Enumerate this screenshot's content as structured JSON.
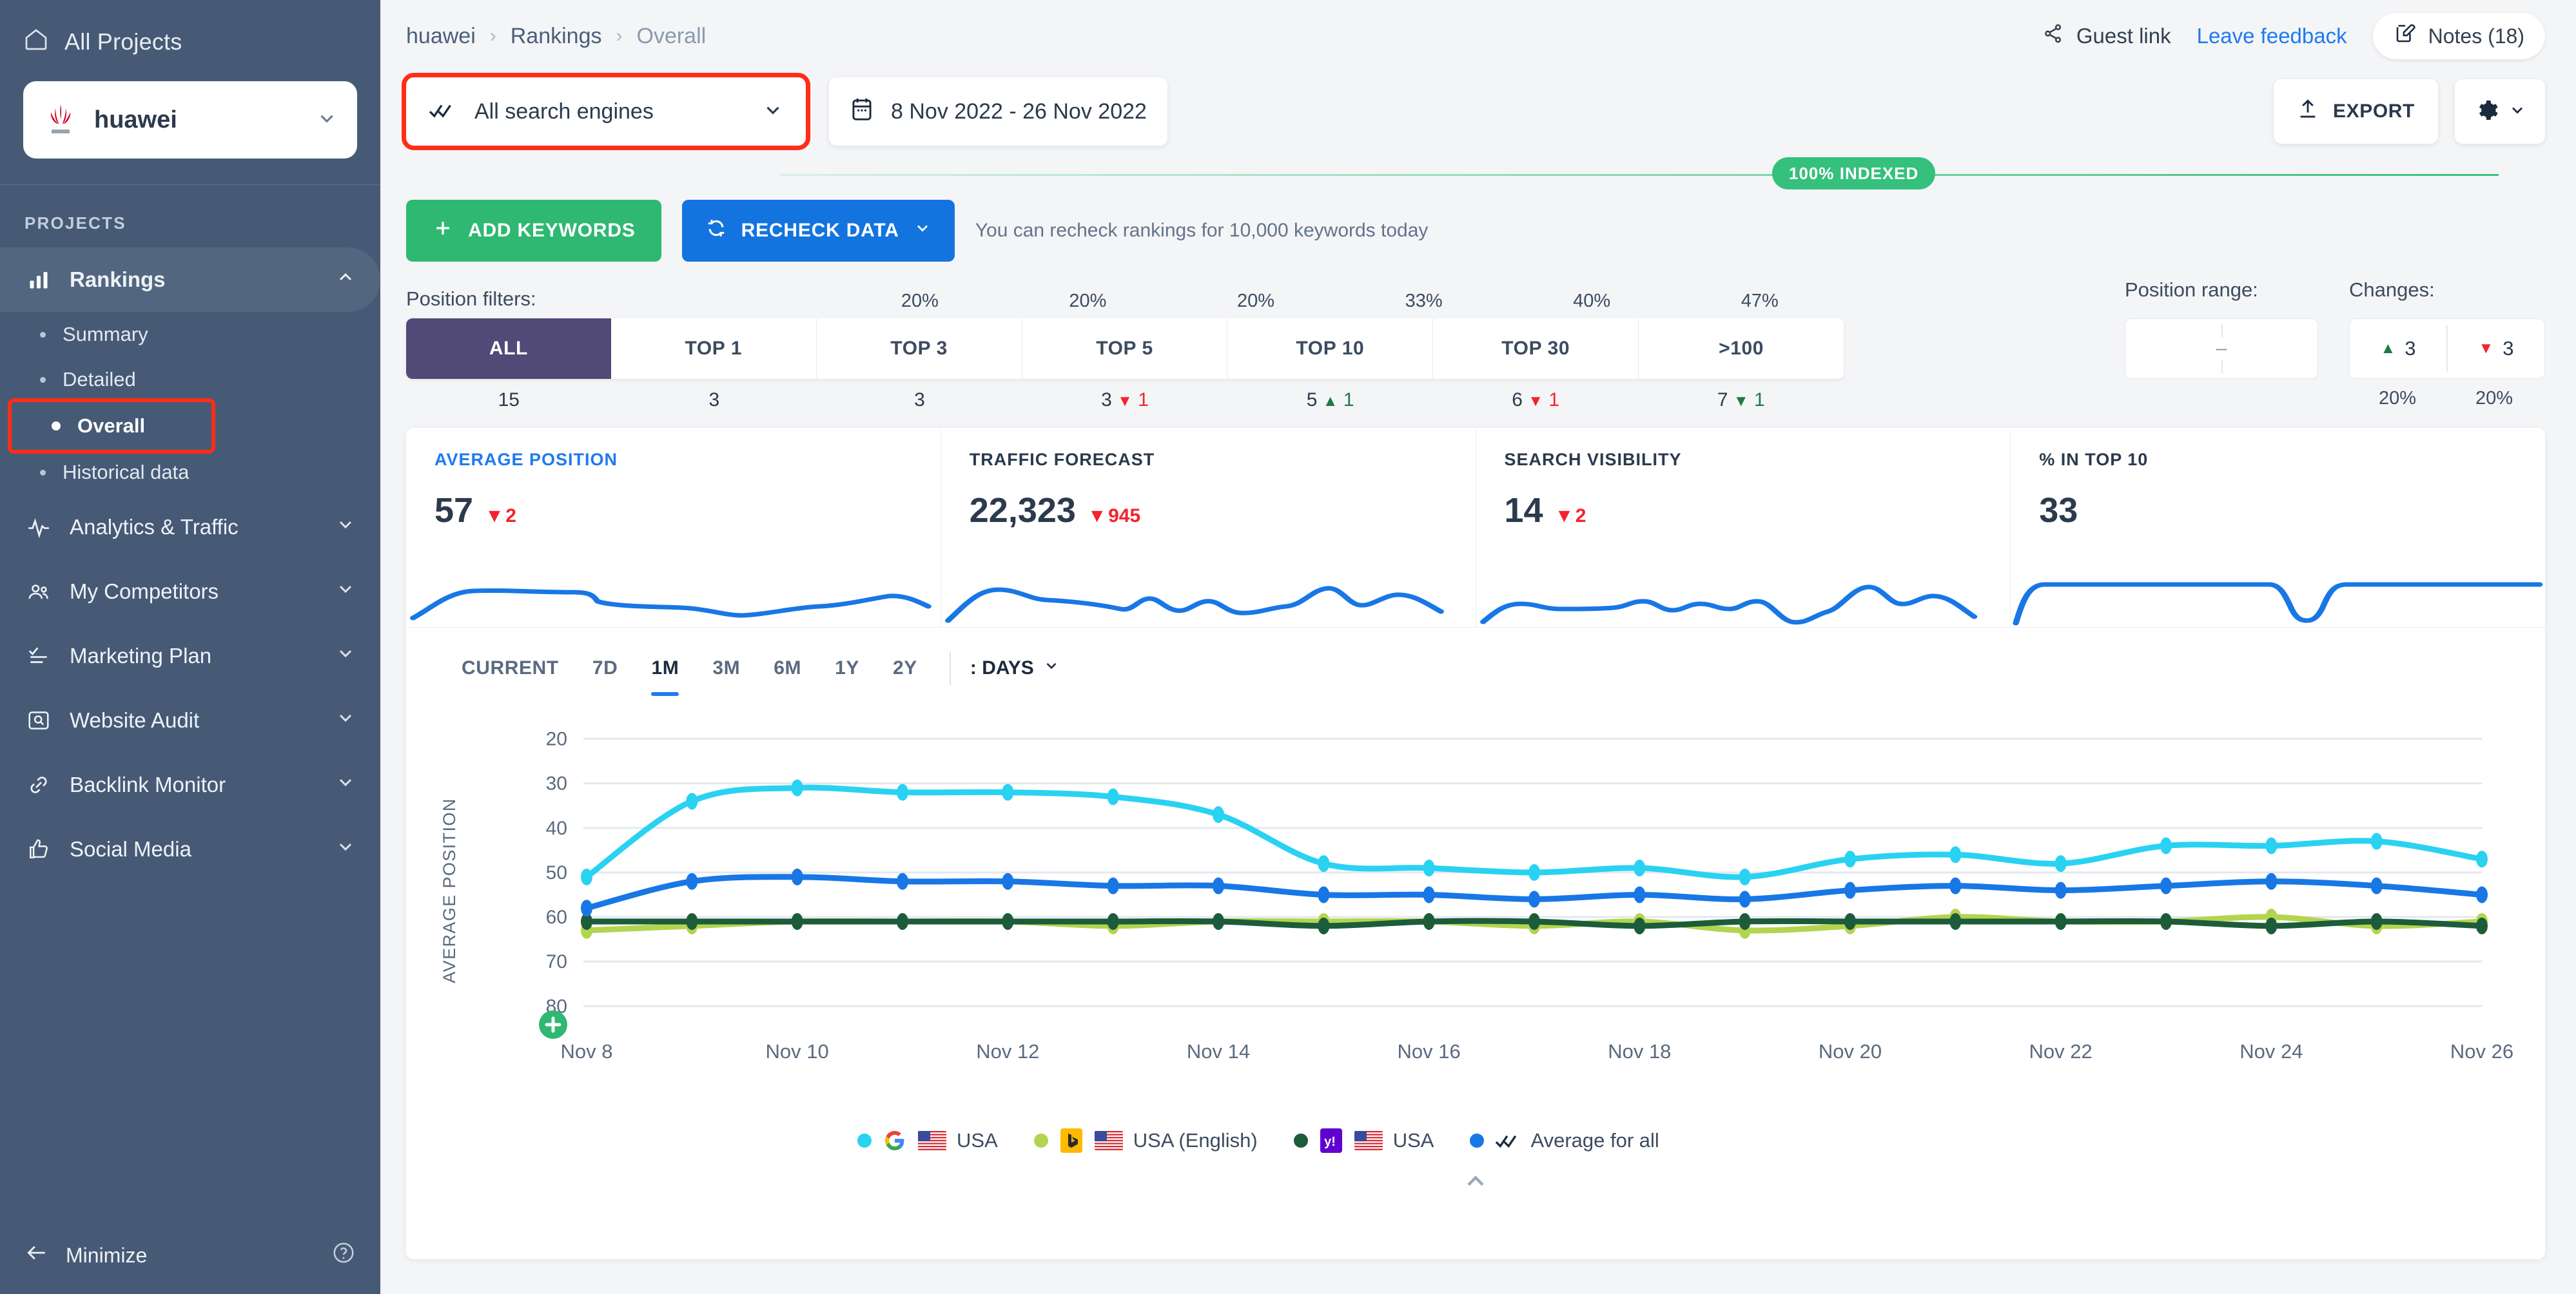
{
  "sidebar": {
    "all_projects": "All Projects",
    "project_name": "huawei",
    "section_label": "PROJECTS",
    "items": [
      {
        "label": "Rankings",
        "icon": "bar-chart-icon",
        "expanded": true
      },
      {
        "label": "Analytics & Traffic",
        "icon": "pulse-icon",
        "expanded": false
      },
      {
        "label": "My Competitors",
        "icon": "people-icon",
        "expanded": false
      },
      {
        "label": "Marketing Plan",
        "icon": "checklist-icon",
        "expanded": false
      },
      {
        "label": "Website Audit",
        "icon": "magnifier-box-icon",
        "expanded": false
      },
      {
        "label": "Backlink Monitor",
        "icon": "link-icon",
        "expanded": false
      },
      {
        "label": "Social Media",
        "icon": "thumbs-up-icon",
        "expanded": false
      }
    ],
    "rankings_sub": [
      "Summary",
      "Detailed",
      "Overall",
      "Historical data"
    ],
    "selected_sub": "Overall",
    "minimize": "Minimize"
  },
  "header": {
    "breadcrumb": [
      "huawei",
      "Rankings",
      "Overall"
    ],
    "guest_link": "Guest link",
    "leave_feedback": "Leave feedback",
    "notes": "Notes (18)"
  },
  "filters": {
    "search_engine": "All search engines",
    "date_range": "8 Nov 2022 - 26 Nov 2022",
    "export": "EXPORT",
    "indexed_badge": "100% INDEXED"
  },
  "actions": {
    "add_keywords": "ADD KEYWORDS",
    "recheck_data": "RECHECK DATA",
    "recheck_note": "You can recheck rankings for 10,000 keywords today"
  },
  "position_filters": {
    "label": "Position filters:",
    "tabs": [
      {
        "label": "ALL",
        "pct": "",
        "count": "15",
        "delta": "",
        "dir": ""
      },
      {
        "label": "TOP 1",
        "pct": "20%",
        "count": "3",
        "delta": "",
        "dir": ""
      },
      {
        "label": "TOP 3",
        "pct": "20%",
        "count": "3",
        "delta": "",
        "dir": ""
      },
      {
        "label": "TOP 5",
        "pct": "20%",
        "count": "3",
        "delta": "1",
        "dir": "down"
      },
      {
        "label": "TOP 10",
        "pct": "33%",
        "count": "5",
        "delta": "1",
        "dir": "up"
      },
      {
        "label": "TOP 30",
        "pct": "40%",
        "count": "6",
        "delta": "1",
        "dir": "down"
      },
      {
        "label": ">100",
        "pct": "47%",
        "count": "7",
        "delta": "1",
        "dir": "down"
      }
    ],
    "active_tab": "ALL"
  },
  "position_range": {
    "title": "Position range:",
    "value": "–"
  },
  "changes": {
    "title": "Changes:",
    "up_count": "3",
    "down_count": "3",
    "up_pct": "20%",
    "down_pct": "20%"
  },
  "kpis": [
    {
      "title": "AVERAGE POSITION",
      "value": "57",
      "delta": "2",
      "dir": "down",
      "active": true
    },
    {
      "title": "TRAFFIC FORECAST",
      "value": "22,323",
      "delta": "945",
      "dir": "down",
      "active": false
    },
    {
      "title": "SEARCH VISIBILITY",
      "value": "14",
      "delta": "2",
      "dir": "down",
      "active": false
    },
    {
      "title": "% IN TOP 10",
      "value": "33",
      "delta": "",
      "dir": "",
      "active": false
    }
  ],
  "time_ranges": {
    "options": [
      "CURRENT",
      "7D",
      "1M",
      "3M",
      "6M",
      "1Y",
      "2Y"
    ],
    "active": "1M",
    "granularity": ": DAYS"
  },
  "chart_data": {
    "type": "line",
    "title": "",
    "xlabel": "",
    "ylabel": "AVERAGE POSITION",
    "yticks": [
      20,
      30,
      40,
      50,
      60,
      70,
      80
    ],
    "ylim": [
      15,
      83
    ],
    "y_inverted": true,
    "grid": true,
    "legend_position": "bottom",
    "x": [
      "Nov 8",
      "Nov 9",
      "Nov 10",
      "Nov 11",
      "Nov 12",
      "Nov 13",
      "Nov 14",
      "Nov 15",
      "Nov 16",
      "Nov 17",
      "Nov 18",
      "Nov 19",
      "Nov 20",
      "Nov 21",
      "Nov 22",
      "Nov 23",
      "Nov 24",
      "Nov 25",
      "Nov 26"
    ],
    "xticks": [
      "Nov 8",
      "Nov 10",
      "Nov 12",
      "Nov 14",
      "Nov 16",
      "Nov 18",
      "Nov 20",
      "Nov 22",
      "Nov 24",
      "Nov 26"
    ],
    "series": [
      {
        "name": "USA",
        "engine": "Google",
        "color": "#2ad2f2",
        "values": [
          51,
          34,
          31,
          32,
          32,
          33,
          37,
          48,
          49,
          50,
          49,
          51,
          47,
          46,
          48,
          44,
          44,
          43,
          47
        ]
      },
      {
        "name": "USA (English)",
        "engine": "Bing",
        "color": "#b3d44f",
        "values": [
          63,
          62,
          61,
          61,
          61,
          62,
          61,
          61,
          61,
          62,
          61,
          63,
          62,
          60,
          61,
          61,
          60,
          62,
          61
        ]
      },
      {
        "name": "USA",
        "engine": "Yahoo",
        "color": "#1c5c3a",
        "values": [
          61,
          61,
          61,
          61,
          61,
          61,
          61,
          62,
          61,
          61,
          62,
          61,
          61,
          61,
          61,
          61,
          62,
          61,
          62
        ]
      },
      {
        "name": "Average for all",
        "engine": "All",
        "color": "#1877e5",
        "values": [
          58,
          52,
          51,
          52,
          52,
          53,
          53,
          55,
          55,
          56,
          55,
          56,
          54,
          53,
          54,
          53,
          52,
          53,
          55
        ]
      }
    ],
    "legend": [
      {
        "label": "USA",
        "color": "#2ad2f2",
        "engine_icon": "google-icon",
        "flag": "us-flag"
      },
      {
        "label": "USA (English)",
        "color": "#b3d44f",
        "engine_icon": "bing-icon",
        "flag": "us-flag"
      },
      {
        "label": "USA",
        "color": "#1c5c3a",
        "engine_icon": "yahoo-icon",
        "flag": "us-flag"
      },
      {
        "label": "Average for all",
        "color": "#1877e5",
        "engine_icon": "all-engines-icon",
        "flag": ""
      }
    ],
    "annotations": [
      {
        "type": "add-note-marker",
        "x": "Nov 8",
        "icon": "plus-circle-icon",
        "color": "#2eb872"
      }
    ]
  },
  "colors": {
    "sidebar_bg": "#465a75",
    "accent_blue": "#1f7af0",
    "green": "#2eb872",
    "red": "#f5222d",
    "purple": "#514a77",
    "highlight": "#ff2d16"
  }
}
